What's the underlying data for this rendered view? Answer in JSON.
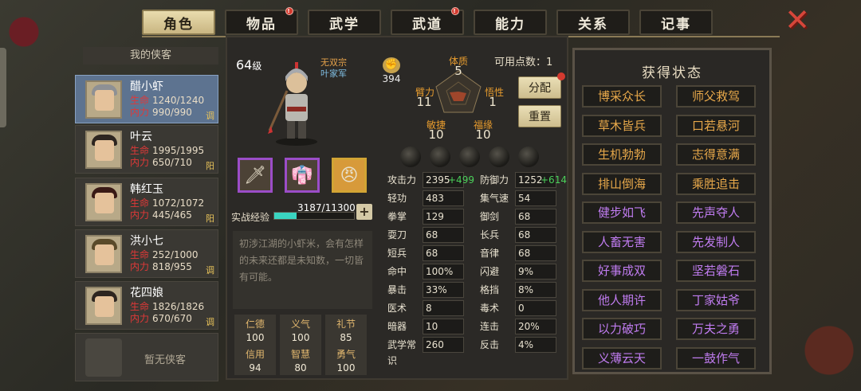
{
  "tabs": [
    {
      "label": "角色",
      "active": true,
      "badge": false
    },
    {
      "label": "物品",
      "active": false,
      "badge": true
    },
    {
      "label": "武学",
      "active": false,
      "badge": false
    },
    {
      "label": "武道",
      "active": false,
      "badge": true
    },
    {
      "label": "能力",
      "active": false,
      "badge": false
    },
    {
      "label": "关系",
      "active": false,
      "badge": false
    },
    {
      "label": "记事",
      "active": false,
      "badge": false
    }
  ],
  "close_icon": "close-icon",
  "list": {
    "header": "我的侠客",
    "heroes": [
      {
        "name": "醋小虾",
        "hp_label": "生命",
        "hp": "1240/1240",
        "mp_label": "内力",
        "mp": "990/990",
        "tag": "调",
        "selected": true
      },
      {
        "name": "叶云",
        "hp_label": "生命",
        "hp": "1995/1995",
        "mp_label": "内力",
        "mp": "650/710",
        "tag": "阳",
        "selected": false
      },
      {
        "name": "韩红玉",
        "hp_label": "生命",
        "hp": "1072/1072",
        "mp_label": "内力",
        "mp": "445/465",
        "tag": "阳",
        "selected": false
      },
      {
        "name": "洪小七",
        "hp_label": "生命",
        "hp": "252/1000",
        "mp_label": "内力",
        "mp": "818/955",
        "tag": "调",
        "selected": false
      },
      {
        "name": "花四娘",
        "hp_label": "生命",
        "hp": "1826/1826",
        "mp_label": "内力",
        "mp": "670/670",
        "tag": "调",
        "selected": false
      }
    ],
    "empty_label": "暂无侠客"
  },
  "character": {
    "level": "64",
    "level_suffix": "级",
    "sect": "无双宗",
    "faction": "叶家军",
    "power": "394",
    "exp_label": "实战经验",
    "exp_text": "3187/11300",
    "exp_fraction": 0.282,
    "plus": "+",
    "description": "初涉江湖的小虾米，会有怎样的未来还都是未知数，一切皆有可能。",
    "virtues": [
      {
        "k": "仁德",
        "v": "100"
      },
      {
        "k": "义气",
        "v": "100"
      },
      {
        "k": "礼节",
        "v": "85"
      },
      {
        "k": "信用",
        "v": "94"
      },
      {
        "k": "智慧",
        "v": "80"
      },
      {
        "k": "勇气",
        "v": "100"
      }
    ]
  },
  "attributes": {
    "points_label": "可用点数：",
    "points": "1",
    "tizhi": {
      "k": "体质",
      "v": "5"
    },
    "wuxing": {
      "k": "悟性",
      "v": "1"
    },
    "fuyuan": {
      "k": "福缘",
      "v": "10"
    },
    "minjie": {
      "k": "敏捷",
      "v": "10"
    },
    "bili": {
      "k": "臂力",
      "v": "11"
    },
    "assign_button": "分配",
    "reset_button": "重置"
  },
  "stats_left": [
    {
      "k": "攻击力",
      "v": "2395",
      "bonus": "+499"
    },
    {
      "k": "轻功",
      "v": "483"
    },
    {
      "k": "拳掌",
      "v": "129"
    },
    {
      "k": "耍刀",
      "v": "68"
    },
    {
      "k": "短兵",
      "v": "68"
    },
    {
      "k": "命中",
      "v": "100%"
    },
    {
      "k": "暴击",
      "v": "33%"
    },
    {
      "k": "医术",
      "v": "8"
    },
    {
      "k": "暗器",
      "v": "10"
    },
    {
      "k": "武学常识",
      "v": "260"
    }
  ],
  "stats_right": [
    {
      "k": "防御力",
      "v": "1252",
      "bonus": "+614"
    },
    {
      "k": "集气速度",
      "v": "54"
    },
    {
      "k": "御剑",
      "v": "68"
    },
    {
      "k": "长兵",
      "v": "68"
    },
    {
      "k": "音律",
      "v": "68"
    },
    {
      "k": "闪避",
      "v": "9%"
    },
    {
      "k": "格挡",
      "v": "8%"
    },
    {
      "k": "毒术",
      "v": "0"
    },
    {
      "k": "连击",
      "v": "20%"
    },
    {
      "k": "反击",
      "v": "4%"
    }
  ],
  "status": {
    "title": "获得状态",
    "items": [
      {
        "t": "博采众长",
        "c": "orange"
      },
      {
        "t": "师父救驾",
        "c": "orange"
      },
      {
        "t": "草木皆兵",
        "c": "orange"
      },
      {
        "t": "口若悬河",
        "c": "orange"
      },
      {
        "t": "生机勃勃",
        "c": "orange"
      },
      {
        "t": "志得意满",
        "c": "orange"
      },
      {
        "t": "排山倒海",
        "c": "orange"
      },
      {
        "t": "乘胜追击",
        "c": "orange"
      },
      {
        "t": "健步如飞",
        "c": "purple"
      },
      {
        "t": "先声夺人",
        "c": "purple"
      },
      {
        "t": "人畜无害",
        "c": "purple"
      },
      {
        "t": "先发制人",
        "c": "purple"
      },
      {
        "t": "好事成双",
        "c": "purple"
      },
      {
        "t": "坚若磐石",
        "c": "purple"
      },
      {
        "t": "他人期许",
        "c": "purple"
      },
      {
        "t": "丁家姑爷",
        "c": "purple"
      },
      {
        "t": "以力破巧",
        "c": "purple"
      },
      {
        "t": "万夫之勇",
        "c": "purple"
      },
      {
        "t": "义薄云天",
        "c": "purple"
      },
      {
        "t": "一鼓作气",
        "c": "purple"
      }
    ]
  },
  "colors": {
    "orange": "#e7a84a",
    "purple": "#c07cf0",
    "exp": "#3ad4c0"
  }
}
